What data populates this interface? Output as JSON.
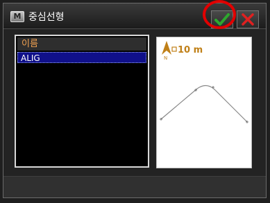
{
  "window": {
    "title": "중심선형",
    "app_icon_letter": "M"
  },
  "toolbar": {
    "ok_icon": "checkmark-icon",
    "close_icon": "close-icon",
    "ok_color": "#2ea82e",
    "close_color": "#e02020",
    "highlight_color": "#e10000"
  },
  "list": {
    "header": "이름",
    "items": [
      {
        "label": "ALIG",
        "selected": true
      }
    ]
  },
  "preview": {
    "north_icon": "north-arrow-icon",
    "scale_text": "10 m"
  }
}
